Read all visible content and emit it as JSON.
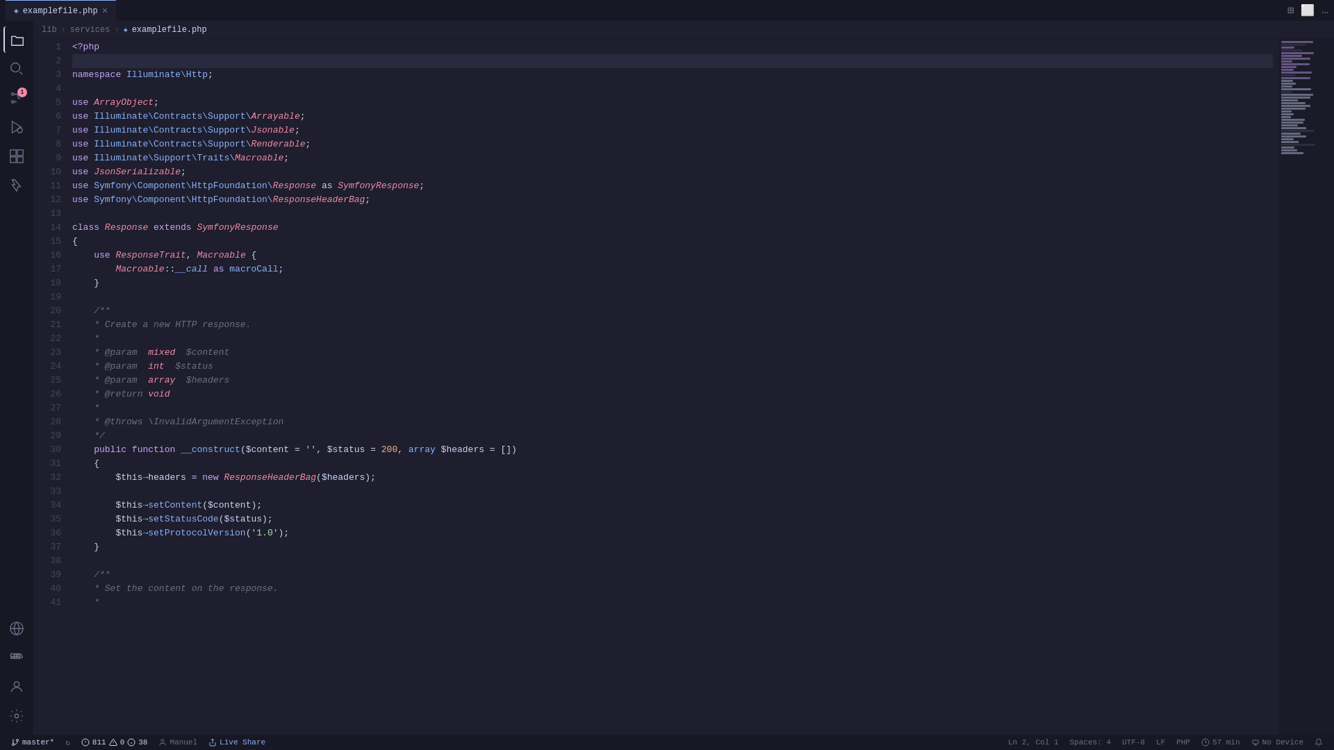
{
  "titleBar": {
    "tab": {
      "label": "examplefile.php",
      "icon": "◈"
    },
    "actions": [
      "⊞",
      "⬜",
      "…"
    ]
  },
  "breadcrumb": {
    "items": [
      "lib",
      "services",
      "examplefile.php"
    ],
    "icons": [
      "◈"
    ]
  },
  "activityBar": {
    "items": [
      {
        "icon": "⎘",
        "name": "explorer"
      },
      {
        "icon": "⌕",
        "name": "search"
      },
      {
        "icon": "⑂",
        "name": "source-control",
        "badge": "1"
      },
      {
        "icon": "▶",
        "name": "run-debug"
      },
      {
        "icon": "⊞",
        "name": "extensions"
      },
      {
        "icon": "🧪",
        "name": "testing"
      }
    ],
    "bottomItems": [
      {
        "icon": "⚡",
        "name": "live-share-bottom"
      },
      {
        "icon": "☺",
        "name": "account"
      },
      {
        "icon": "⚙",
        "name": "settings"
      }
    ]
  },
  "statusBar": {
    "branch": "master*",
    "sync_icon": "↻",
    "errors": "811",
    "warnings": "0",
    "infos": "38",
    "user": "Manuel",
    "liveshare": "Live Share",
    "position": "Ln 2, Col 1",
    "spaces": "Spaces: 4",
    "encoding": "UTF-8",
    "lineEnding": "LF",
    "language": "PHP",
    "time": "57 min",
    "device": "No Device"
  },
  "code": {
    "lines": [
      {
        "num": 1,
        "tokens": [
          {
            "t": "kw",
            "v": "<?php"
          }
        ]
      },
      {
        "num": 2,
        "tokens": [],
        "active": true
      },
      {
        "num": 3,
        "tokens": [
          {
            "t": "kw",
            "v": "namespace"
          },
          {
            "t": "var",
            "v": " "
          },
          {
            "t": "ns",
            "v": "Illuminate\\Http"
          },
          {
            "t": "var",
            "v": ";"
          }
        ]
      },
      {
        "num": 4,
        "tokens": []
      },
      {
        "num": 5,
        "tokens": [
          {
            "t": "kw",
            "v": "use"
          },
          {
            "t": "var",
            "v": " "
          },
          {
            "t": "italic-cls",
            "v": "ArrayObject"
          },
          {
            "t": "var",
            "v": ";"
          }
        ]
      },
      {
        "num": 6,
        "tokens": [
          {
            "t": "kw",
            "v": "use"
          },
          {
            "t": "var",
            "v": " "
          },
          {
            "t": "ns",
            "v": "Illuminate\\Contracts\\Support\\"
          },
          {
            "t": "italic-cls",
            "v": "Arrayable"
          },
          {
            "t": "var",
            "v": ";"
          }
        ]
      },
      {
        "num": 7,
        "tokens": [
          {
            "t": "kw",
            "v": "use"
          },
          {
            "t": "var",
            "v": " "
          },
          {
            "t": "ns",
            "v": "Illuminate\\Contracts\\Support\\"
          },
          {
            "t": "italic-cls",
            "v": "Jsonable"
          },
          {
            "t": "var",
            "v": ";"
          }
        ]
      },
      {
        "num": 8,
        "tokens": [
          {
            "t": "kw",
            "v": "use"
          },
          {
            "t": "var",
            "v": " "
          },
          {
            "t": "ns",
            "v": "Illuminate\\Contracts\\Support\\"
          },
          {
            "t": "italic-cls",
            "v": "Renderable"
          },
          {
            "t": "var",
            "v": ";"
          }
        ]
      },
      {
        "num": 9,
        "tokens": [
          {
            "t": "kw",
            "v": "use"
          },
          {
            "t": "var",
            "v": " "
          },
          {
            "t": "ns",
            "v": "Illuminate\\Support\\Traits\\"
          },
          {
            "t": "italic-cls",
            "v": "Macroable"
          },
          {
            "t": "var",
            "v": ";"
          }
        ]
      },
      {
        "num": 10,
        "tokens": [
          {
            "t": "kw",
            "v": "use"
          },
          {
            "t": "var",
            "v": " "
          },
          {
            "t": "italic-cls",
            "v": "JsonSerializable"
          },
          {
            "t": "var",
            "v": ";"
          }
        ]
      },
      {
        "num": 11,
        "tokens": [
          {
            "t": "kw",
            "v": "use"
          },
          {
            "t": "var",
            "v": " "
          },
          {
            "t": "ns",
            "v": "Symfony\\Component\\HttpFoundation\\"
          },
          {
            "t": "italic-cls",
            "v": "Response"
          },
          {
            "t": "var",
            "v": " as "
          },
          {
            "t": "italic-cls",
            "v": "SymfonyResponse"
          },
          {
            "t": "var",
            "v": ";"
          }
        ]
      },
      {
        "num": 12,
        "tokens": [
          {
            "t": "kw",
            "v": "use"
          },
          {
            "t": "var",
            "v": " "
          },
          {
            "t": "ns",
            "v": "Symfony\\Component\\HttpFoundation\\"
          },
          {
            "t": "italic-cls",
            "v": "ResponseHeaderBag"
          },
          {
            "t": "var",
            "v": ";"
          }
        ]
      },
      {
        "num": 13,
        "tokens": []
      },
      {
        "num": 14,
        "tokens": [
          {
            "t": "kw",
            "v": "class"
          },
          {
            "t": "var",
            "v": " "
          },
          {
            "t": "italic-cls",
            "v": "Response"
          },
          {
            "t": "var",
            "v": " "
          },
          {
            "t": "kw",
            "v": "extends"
          },
          {
            "t": "var",
            "v": " "
          },
          {
            "t": "italic-cls",
            "v": "SymfonyResponse"
          }
        ]
      },
      {
        "num": 15,
        "tokens": [
          {
            "t": "var",
            "v": "{"
          }
        ]
      },
      {
        "num": 16,
        "tokens": [
          {
            "t": "var",
            "v": "    "
          },
          {
            "t": "kw",
            "v": "use"
          },
          {
            "t": "var",
            "v": " "
          },
          {
            "t": "italic-cls",
            "v": "ResponseTrait"
          },
          {
            "t": "var",
            "v": ", "
          },
          {
            "t": "italic-cls",
            "v": "Macroable"
          },
          {
            "t": "var",
            "v": " {"
          }
        ]
      },
      {
        "num": 17,
        "tokens": [
          {
            "t": "var",
            "v": "        "
          },
          {
            "t": "italic-cls",
            "v": "Macroable"
          },
          {
            "t": "var",
            "v": "::"
          },
          {
            "t": "italic-fn",
            "v": "__call"
          },
          {
            "t": "var",
            "v": " "
          },
          {
            "t": "kw",
            "v": "as"
          },
          {
            "t": "var",
            "v": " "
          },
          {
            "t": "fn",
            "v": "macroCall"
          },
          {
            "t": "var",
            "v": ";"
          }
        ]
      },
      {
        "num": 18,
        "tokens": [
          {
            "t": "var",
            "v": "    }"
          }
        ]
      },
      {
        "num": 19,
        "tokens": []
      },
      {
        "num": 20,
        "tokens": [
          {
            "t": "var",
            "v": "    "
          },
          {
            "t": "comment",
            "v": "/**"
          }
        ]
      },
      {
        "num": 21,
        "tokens": [
          {
            "t": "var",
            "v": "    "
          },
          {
            "t": "comment",
            "v": "* Create a new HTTP response."
          }
        ]
      },
      {
        "num": 22,
        "tokens": [
          {
            "t": "var",
            "v": "    "
          },
          {
            "t": "comment",
            "v": "*"
          }
        ]
      },
      {
        "num": 23,
        "tokens": [
          {
            "t": "var",
            "v": "    "
          },
          {
            "t": "comment",
            "v": "* @param  "
          },
          {
            "t": "param-kw",
            "v": "mixed"
          },
          {
            "t": "comment",
            "v": "  $content"
          }
        ]
      },
      {
        "num": 24,
        "tokens": [
          {
            "t": "var",
            "v": "    "
          },
          {
            "t": "comment",
            "v": "* @param  "
          },
          {
            "t": "param-kw",
            "v": "int"
          },
          {
            "t": "comment",
            "v": "  $status"
          }
        ]
      },
      {
        "num": 25,
        "tokens": [
          {
            "t": "var",
            "v": "    "
          },
          {
            "t": "comment",
            "v": "* @param  "
          },
          {
            "t": "param-kw",
            "v": "array"
          },
          {
            "t": "comment",
            "v": "  $headers"
          }
        ]
      },
      {
        "num": 26,
        "tokens": [
          {
            "t": "var",
            "v": "    "
          },
          {
            "t": "comment",
            "v": "* @return "
          },
          {
            "t": "param-kw",
            "v": "void"
          }
        ]
      },
      {
        "num": 27,
        "tokens": [
          {
            "t": "var",
            "v": "    "
          },
          {
            "t": "comment",
            "v": "*"
          }
        ]
      },
      {
        "num": 28,
        "tokens": [
          {
            "t": "var",
            "v": "    "
          },
          {
            "t": "comment",
            "v": "* @throws \\InvalidArgumentException"
          }
        ]
      },
      {
        "num": 29,
        "tokens": [
          {
            "t": "var",
            "v": "    "
          },
          {
            "t": "comment",
            "v": "*/"
          }
        ]
      },
      {
        "num": 30,
        "tokens": [
          {
            "t": "var",
            "v": "    "
          },
          {
            "t": "kw",
            "v": "public"
          },
          {
            "t": "var",
            "v": " "
          },
          {
            "t": "kw",
            "v": "function"
          },
          {
            "t": "var",
            "v": " "
          },
          {
            "t": "fn",
            "v": "__construct"
          },
          {
            "t": "var",
            "v": "("
          },
          {
            "t": "var",
            "v": "$content"
          },
          {
            "t": "var",
            "v": " = "
          },
          {
            "t": "str",
            "v": "''"
          },
          {
            "t": "var",
            "v": ", "
          },
          {
            "t": "var",
            "v": "$status"
          },
          {
            "t": "var",
            "v": " = "
          },
          {
            "t": "num",
            "v": "200"
          },
          {
            "t": "var",
            "v": ", "
          },
          {
            "t": "kw2",
            "v": "array"
          },
          {
            "t": "var",
            "v": " $headers = [])"
          }
        ]
      },
      {
        "num": 31,
        "tokens": [
          {
            "t": "var",
            "v": "    {"
          }
        ]
      },
      {
        "num": 32,
        "tokens": [
          {
            "t": "var",
            "v": "        $this"
          },
          {
            "t": "op",
            "v": "→"
          },
          {
            "t": "var",
            "v": "headers = "
          },
          {
            "t": "kw",
            "v": "new"
          },
          {
            "t": "var",
            "v": " "
          },
          {
            "t": "italic-cls",
            "v": "ResponseHeaderBag"
          },
          {
            "t": "var",
            "v": "($headers);"
          }
        ]
      },
      {
        "num": 33,
        "tokens": []
      },
      {
        "num": 34,
        "tokens": [
          {
            "t": "var",
            "v": "        $this"
          },
          {
            "t": "op",
            "v": "→"
          },
          {
            "t": "fn",
            "v": "setContent"
          },
          {
            "t": "var",
            "v": "($content);"
          }
        ]
      },
      {
        "num": 35,
        "tokens": [
          {
            "t": "var",
            "v": "        $this"
          },
          {
            "t": "op",
            "v": "→"
          },
          {
            "t": "fn",
            "v": "setStatusCode"
          },
          {
            "t": "var",
            "v": "($status);"
          }
        ]
      },
      {
        "num": 36,
        "tokens": [
          {
            "t": "var",
            "v": "        $this"
          },
          {
            "t": "op",
            "v": "→"
          },
          {
            "t": "fn",
            "v": "setProtocolVersion"
          },
          {
            "t": "var",
            "v": "("
          },
          {
            "t": "str",
            "v": "'1.0'"
          },
          {
            "t": "var",
            "v": ");"
          }
        ]
      },
      {
        "num": 37,
        "tokens": [
          {
            "t": "var",
            "v": "    }"
          }
        ]
      },
      {
        "num": 38,
        "tokens": []
      },
      {
        "num": 39,
        "tokens": [
          {
            "t": "var",
            "v": "    "
          },
          {
            "t": "comment",
            "v": "/**"
          }
        ]
      },
      {
        "num": 40,
        "tokens": [
          {
            "t": "var",
            "v": "    "
          },
          {
            "t": "comment",
            "v": "* Set the content on the response."
          }
        ]
      },
      {
        "num": 41,
        "tokens": [
          {
            "t": "var",
            "v": "    "
          },
          {
            "t": "comment",
            "v": "*"
          }
        ]
      }
    ]
  }
}
